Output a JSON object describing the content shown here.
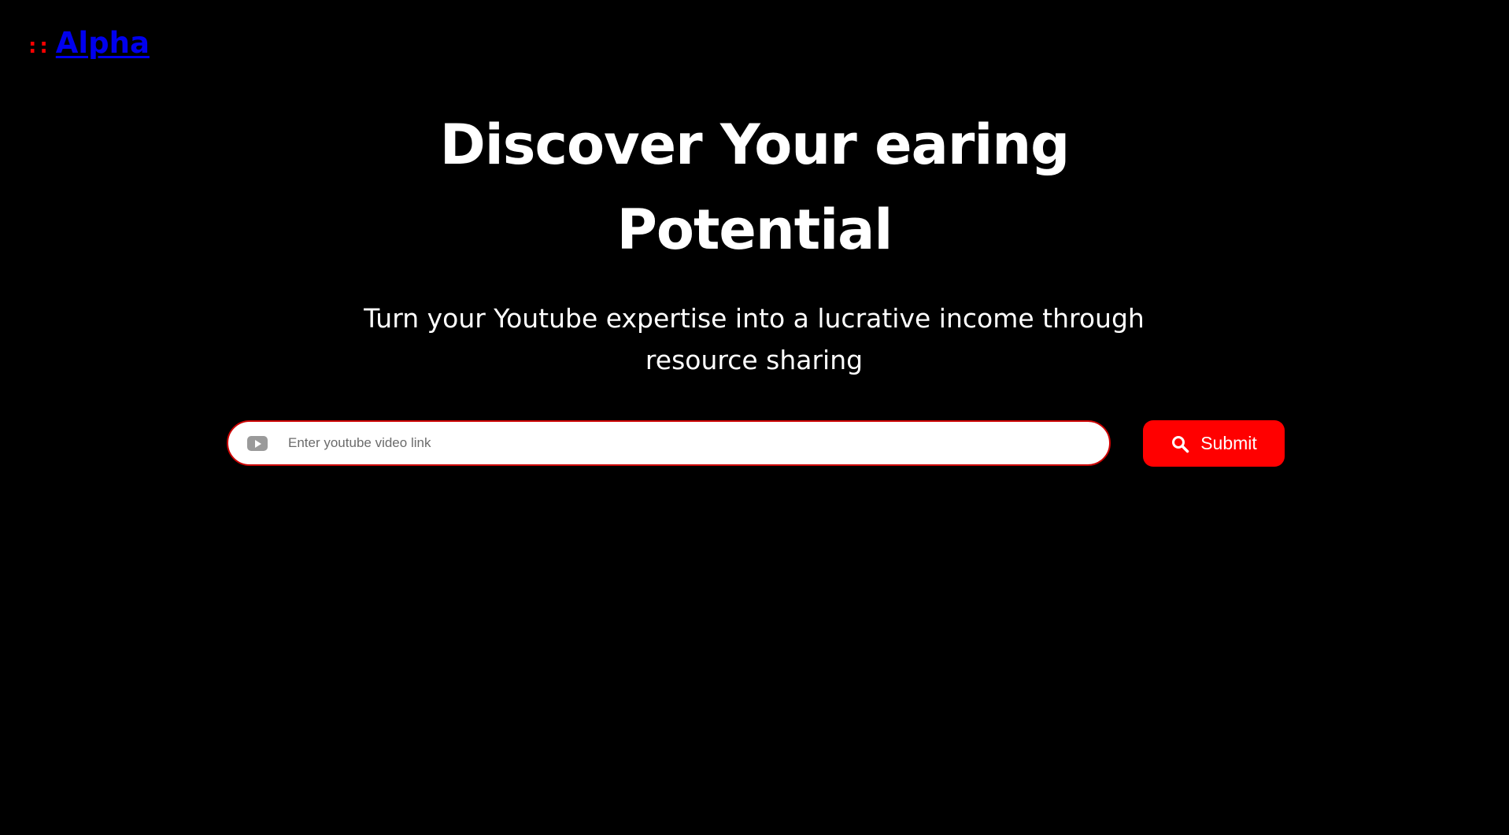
{
  "header": {
    "logo_dots": "::",
    "logo_text": "Alpha"
  },
  "hero": {
    "title_line1": "Discover Your earing",
    "title_line2": "Potential",
    "subtitle": "Turn your Youtube expertise into a lucrative income through resource sharing"
  },
  "search": {
    "placeholder": "Enter youtube video link",
    "value": "",
    "icon": "youtube-icon"
  },
  "submit": {
    "label": "Submit",
    "icon": "search-icon"
  },
  "colors": {
    "background": "#000000",
    "accent": "#ff0000",
    "link": "#0000ee",
    "text": "#ffffff"
  }
}
